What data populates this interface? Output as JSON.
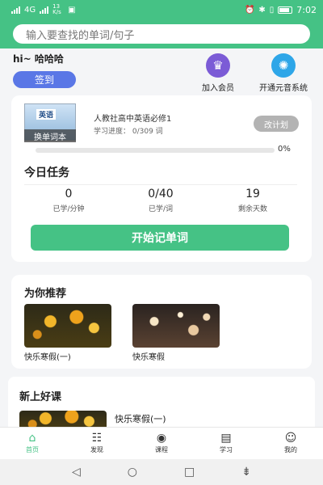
{
  "statusbar": {
    "time": "7:02",
    "network": "4G",
    "speed": "13 K/s"
  },
  "search": {
    "placeholder": "输入要查找的单词/句子"
  },
  "greeting": "hi~ 哈哈哈",
  "checkin_label": "签到",
  "features": [
    {
      "label": "加入会员",
      "icon": "crown-icon",
      "color": "#7b5bd6"
    },
    {
      "label": "开通元音系统",
      "icon": "atom-icon",
      "color": "#2ea6e8"
    }
  ],
  "book": {
    "cover_text": "英语",
    "swap_label": "换单词本",
    "title": "人教社高中英语必修1",
    "progress_text": "学习进度： 0/309 词",
    "edit_label": "改计划",
    "progress_percent": "0%",
    "progress_value": 0
  },
  "task": {
    "title": "今日任务",
    "stats": [
      {
        "value": "0",
        "label": "已学/分钟"
      },
      {
        "value": "0/40",
        "label": "已学/词"
      },
      {
        "value": "19",
        "label": "剩余天数"
      }
    ],
    "start_label": "开始记单词"
  },
  "recommend": {
    "title": "为你推荐",
    "items": [
      {
        "caption": "快乐寒假(一)"
      },
      {
        "caption": "快乐寒假"
      }
    ]
  },
  "new_courses": {
    "title": "新上好课",
    "first_item": "快乐寒假(一)"
  },
  "tabs": [
    {
      "label": "首页",
      "icon": "home-icon",
      "active": true
    },
    {
      "label": "发现",
      "icon": "discover-icon",
      "active": false
    },
    {
      "label": "课程",
      "icon": "course-icon",
      "active": false
    },
    {
      "label": "学习",
      "icon": "book-icon",
      "active": false
    },
    {
      "label": "我的",
      "icon": "profile-icon",
      "active": false
    }
  ],
  "colors": {
    "accent": "#45c285",
    "checkin": "#5a77e6"
  }
}
